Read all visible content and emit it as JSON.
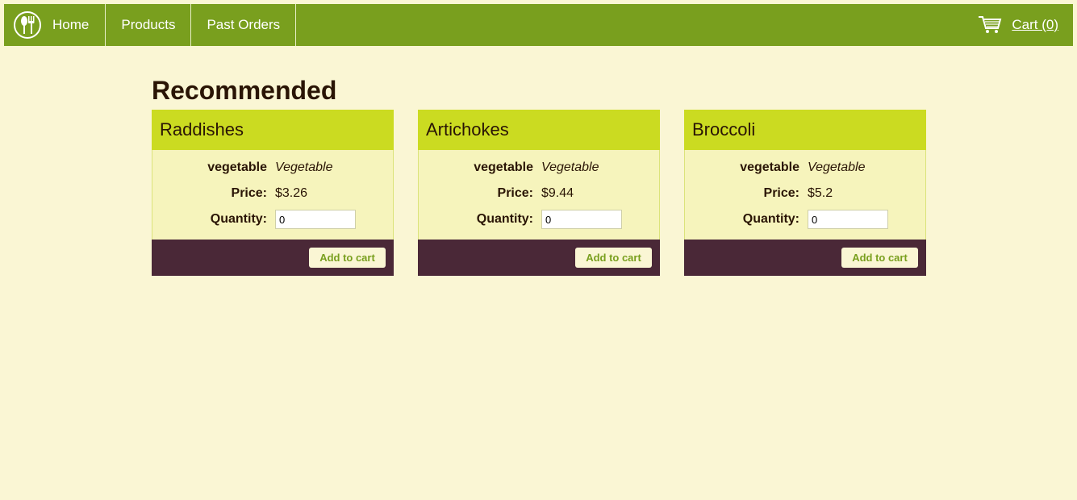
{
  "nav": {
    "brand_icon": "fork-spoon-logo-icon",
    "home_label": "Home",
    "items": [
      {
        "label": "Products"
      },
      {
        "label": "Past Orders"
      }
    ],
    "cart_icon": "shopping-cart-icon",
    "cart_label": "Cart (0)"
  },
  "colors": {
    "background": "#faf6d4",
    "navbar": "#799f1e",
    "card_header": "#cbdb21",
    "card_body": "#f6f4bc",
    "card_footer": "#4a2837",
    "button_text": "#799f1e"
  },
  "main": {
    "heading": "Recommended",
    "products": [
      {
        "name": "Raddishes",
        "category_label": "vegetable",
        "category_value": "Vegetable",
        "price_label": "Price:",
        "price": "$3.26",
        "quantity_label": "Quantity:",
        "quantity": "0",
        "add_label": "Add to cart"
      },
      {
        "name": "Artichokes",
        "category_label": "vegetable",
        "category_value": "Vegetable",
        "price_label": "Price:",
        "price": "$9.44",
        "quantity_label": "Quantity:",
        "quantity": "0",
        "add_label": "Add to cart"
      },
      {
        "name": "Broccoli",
        "category_label": "vegetable",
        "category_value": "Vegetable",
        "price_label": "Price:",
        "price": "$5.2",
        "quantity_label": "Quantity:",
        "quantity": "0",
        "add_label": "Add to cart"
      }
    ]
  }
}
